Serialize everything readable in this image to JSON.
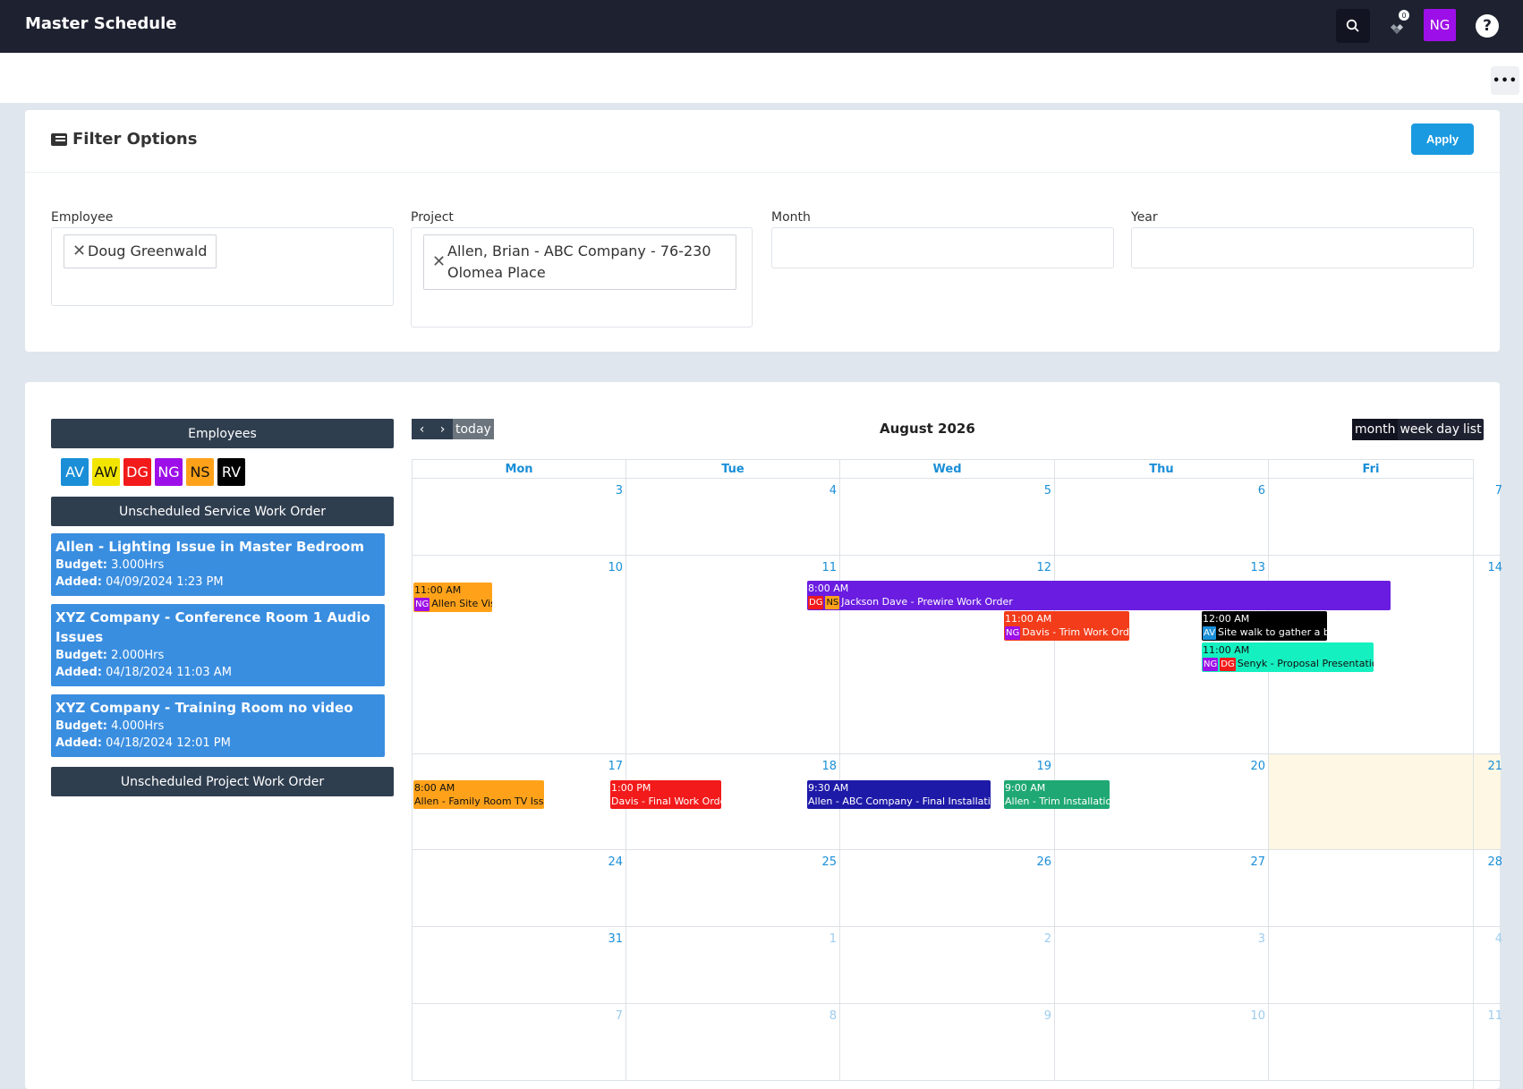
{
  "app": {
    "title": "Master Schedule"
  },
  "topbar": {
    "notification_count": "0",
    "avatar_initials": "NG",
    "help_label": "?"
  },
  "subbar": {
    "more_label": "•••"
  },
  "filter": {
    "title": "Filter Options",
    "apply_label": "Apply",
    "employee": {
      "label": "Employee",
      "chip": "Doug Greenwald"
    },
    "project": {
      "label": "Project",
      "chip_line1": "Allen, Brian - ABC Company - 76-230",
      "chip_line2": "Olomea Place"
    },
    "month": {
      "label": "Month",
      "value": ""
    },
    "year": {
      "label": "Year",
      "value": ""
    }
  },
  "sidebar": {
    "employees_label": "Employees",
    "employee_badges": [
      {
        "initials": "AV",
        "bg": "#1a8fd8",
        "fg": "#ffffff"
      },
      {
        "initials": "AW",
        "bg": "#f2e600",
        "fg": "#111111"
      },
      {
        "initials": "DG",
        "bg": "#f21a1a",
        "fg": "#ffffff"
      },
      {
        "initials": "NG",
        "bg": "#9d0fe8",
        "fg": "#ffffff"
      },
      {
        "initials": "NS",
        "bg": "#ffa21a",
        "fg": "#111111"
      },
      {
        "initials": "RV",
        "bg": "#000000",
        "fg": "#ffffff"
      }
    ],
    "unscheduled_service_label": "Unscheduled Service Work Order",
    "unscheduled_project_label": "Unscheduled Project Work Order",
    "work_orders": [
      {
        "title": "Allen - Lighting Issue in Master Bedroom",
        "budget_label": "Budget:",
        "budget": "3.000Hrs",
        "added_label": "Added:",
        "added": "04/09/2024 1:23 PM"
      },
      {
        "title": "XYZ Company - Conference Room 1 Audio Issues",
        "budget_label": "Budget:",
        "budget": "2.000Hrs",
        "added_label": "Added:",
        "added": "04/18/2024 11:03 AM"
      },
      {
        "title": "XYZ Company - Training Room no video",
        "budget_label": "Budget:",
        "budget": "4.000Hrs",
        "added_label": "Added:",
        "added": "04/18/2024 12:01 PM"
      }
    ]
  },
  "calendar": {
    "title": "August 2026",
    "today_label": "today",
    "views": [
      "month",
      "week",
      "day",
      "list"
    ],
    "weekdays": [
      "Mon",
      "Tue",
      "Wed",
      "Thu",
      "Fri"
    ],
    "weeks": [
      [
        "3",
        "4",
        "5",
        "6",
        "7"
      ],
      [
        "10",
        "11",
        "12",
        "13",
        "14"
      ],
      [
        "17",
        "18",
        "19",
        "20",
        "21"
      ],
      [
        "24",
        "25",
        "26",
        "27",
        "28"
      ],
      [
        "31",
        "1",
        "2",
        "3",
        "4"
      ],
      [
        "7",
        "8",
        "9",
        "10",
        "11"
      ]
    ],
    "events": [
      {
        "time": "11:00 AM",
        "tags": [
          "NG"
        ],
        "title": "Allen Site Visit",
        "bg": "#ffa21a",
        "fg": "#111111"
      },
      {
        "time": "8:00 AM",
        "tags": [
          "DG",
          "NS"
        ],
        "title": "Jackson Dave - Prewire Work Order",
        "bg": "#6a1de0",
        "fg": "#ffffff"
      },
      {
        "time": "11:00 AM",
        "tags": [
          "NG"
        ],
        "title": "Davis - Trim Work Order",
        "bg": "#f23c1a",
        "fg": "#ffffff"
      },
      {
        "time": "12:00 AM",
        "tags": [
          "AV"
        ],
        "title": "Site walk to gather a bid",
        "bg": "#000000",
        "fg": "#ffffff"
      },
      {
        "time": "11:00 AM",
        "tags": [
          "NG",
          "DG"
        ],
        "title": "Senyk - Proposal Presentation",
        "bg": "#15f0c0",
        "fg": "#111111"
      },
      {
        "time": "8:00 AM",
        "tags": [],
        "title": "Allen - Family Room TV Issue",
        "bg": "#ffa21a",
        "fg": "#111111"
      },
      {
        "time": "1:00 PM",
        "tags": [],
        "title": "Davis - Final Work Order",
        "bg": "#f21a1a",
        "fg": "#ffffff"
      },
      {
        "time": "9:30 AM",
        "tags": [],
        "title": "Allen - ABC Company - Final Installation",
        "bg": "#1e1aa8",
        "fg": "#ffffff"
      },
      {
        "time": "9:00 AM",
        "tags": [],
        "title": "Allen - Trim Installation",
        "bg": "#1fa873",
        "fg": "#ffffff"
      }
    ],
    "tag_colors": {
      "AV": "#1a8fd8",
      "AW": "#f2e600",
      "DG": "#f21a1a",
      "NG": "#9d0fe8",
      "NS": "#ffa21a",
      "RV": "#000000"
    }
  }
}
